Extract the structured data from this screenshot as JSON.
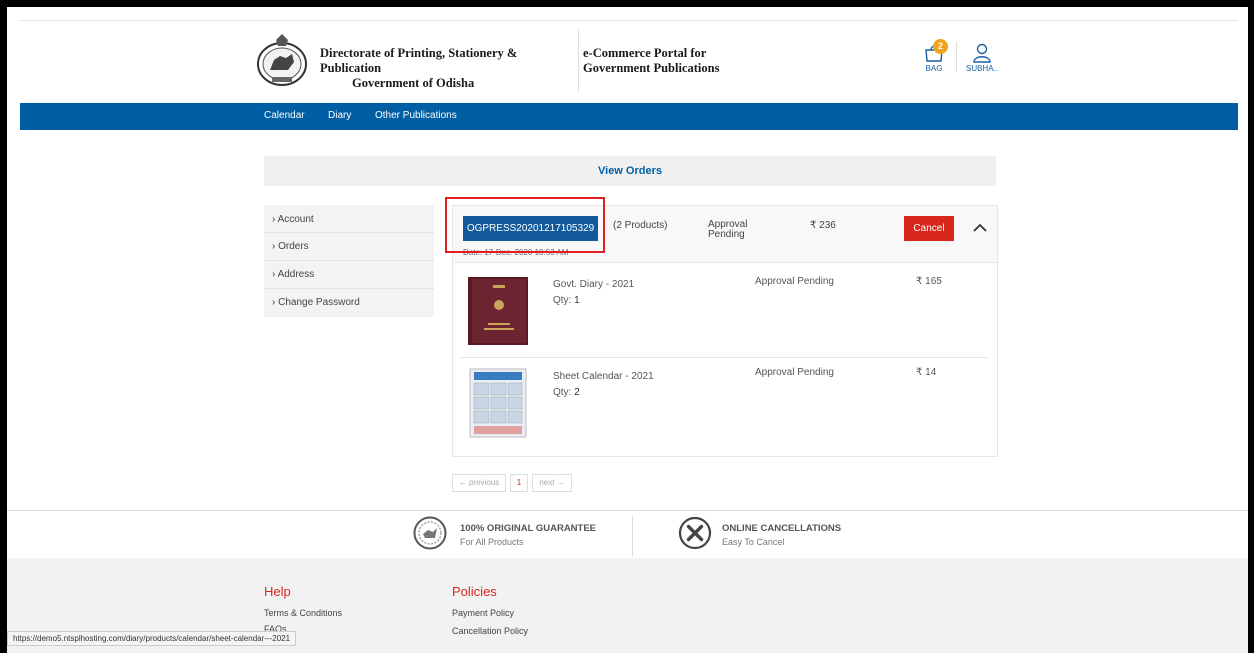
{
  "header": {
    "directorate_line1": "Directorate of Printing, Stationery & Publication",
    "directorate_line2": "Government of Odisha",
    "portal_line1": "e-Commerce Portal for",
    "portal_line2": "Government Publications",
    "bag_label": "BAG",
    "bag_count": "2",
    "user_label": "SUBHA..",
    "logo_icon": "odisha-emblem-icon",
    "bag_icon": "shopping-bag-icon",
    "user_icon": "user-icon"
  },
  "nav": {
    "items": [
      "Calendar",
      "Diary",
      "Other Publications"
    ]
  },
  "page": {
    "title": "View Orders"
  },
  "sidebar": {
    "items": [
      "Account",
      "Orders",
      "Address",
      "Change Password"
    ]
  },
  "order": {
    "id": "OGPRESS20201217105329",
    "date": "Date: 17-Dec, 2020 10:53 AM",
    "products_count": "(2 Products)",
    "status": "Approval Pending",
    "total": "₹ 236",
    "cancel_label": "Cancel",
    "items": [
      {
        "name": "Govt. Diary - 2021",
        "qty_label": "Qty:",
        "qty": "1",
        "status": "Approval Pending",
        "price": "₹ 165"
      },
      {
        "name": "Sheet Calendar - 2021",
        "qty_label": "Qty:",
        "qty": "2",
        "status": "Approval Pending",
        "price": "₹ 14"
      }
    ]
  },
  "pagination": {
    "previous": "← previous",
    "current": "1",
    "next": "next →"
  },
  "features": [
    {
      "title": "100% ORIGINAL GUARANTEE",
      "subtitle": "For All Products",
      "icon": "original-seal-icon"
    },
    {
      "title": "ONLINE CANCELLATIONS",
      "subtitle": "Easy To Cancel",
      "icon": "cancel-circle-icon"
    }
  ],
  "footer": {
    "help_heading": "Help",
    "help_links": [
      "Terms & Conditions",
      "FAQs"
    ],
    "policies_heading": "Policies",
    "policies_links": [
      "Payment Policy",
      "Cancellation Policy"
    ]
  },
  "status_bar": {
    "url": "https://demo5.ntsplhosting.com/diary/products/calendar/sheet-calendar---2021"
  },
  "colors": {
    "primary_blue": "#005ea5",
    "cancel_red": "#d8281b",
    "badge_orange": "#f0a31c",
    "highlight_red": "#e02020"
  }
}
